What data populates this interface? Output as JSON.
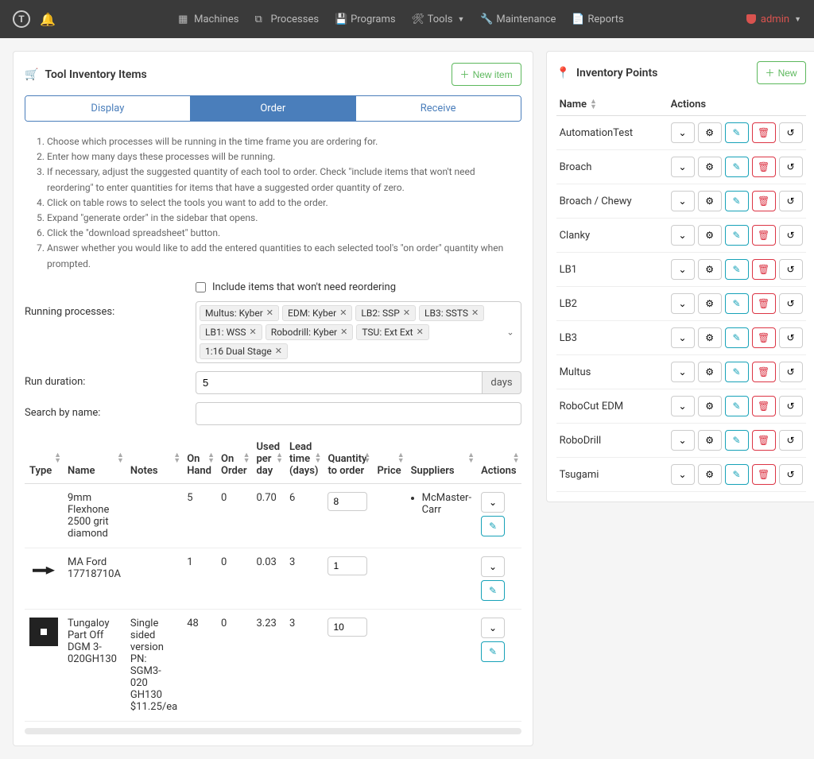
{
  "nav": {
    "items": [
      "Machines",
      "Processes",
      "Programs",
      "Tools",
      "Maintenance",
      "Reports"
    ],
    "user": "admin"
  },
  "left": {
    "title": "Tool Inventory Items",
    "new_btn": "New item",
    "tabs": {
      "display": "Display",
      "order": "Order",
      "receive": "Receive"
    },
    "instructions": [
      "Choose which processes will be running in the time frame you are ordering for.",
      "Enter how many days these processes will be running.",
      "If necessary, adjust the suggested quantity of each tool to order. Check \"include items that won't need reordering\" to enter quantities for items that have a suggested order quantity of zero.",
      "Click on table rows to select the tools you want to add to the order.",
      "Expand \"generate order\" in the sidebar that opens.",
      "Click the \"download spreadsheet\" button.",
      "Answer whether you would like to add the entered quantities to each selected tool's \"on order\" quantity when prompted."
    ],
    "include_label": "Include items that won't need reordering",
    "include_checked": false,
    "running_label": "Running processes:",
    "tags": [
      {
        "label": "Multus: Kyber",
        "removable": true
      },
      {
        "label": "EDM: Kyber",
        "removable": true
      },
      {
        "label": "LB2: SSP",
        "removable": true
      },
      {
        "label": "LB3: SSTS",
        "removable": true
      },
      {
        "label": "LB1: WSS",
        "removable": true
      },
      {
        "label": "Robodrill: Kyber",
        "removable": true
      },
      {
        "label": "TSU: Ext Ext",
        "removable": true
      },
      {
        "label": "1:16 Dual Stage",
        "removable": true
      }
    ],
    "duration_label": "Run duration:",
    "duration_value": "5",
    "duration_unit": "days",
    "search_label": "Search by name:",
    "search_value": "",
    "columns": [
      "Type",
      "Name",
      "Notes",
      "On Hand",
      "On Order",
      "Used per day",
      "Lead time (days)",
      "Quantity to order",
      "Price",
      "Suppliers",
      "Actions"
    ],
    "rows": [
      {
        "thumb": "",
        "name": "9mm Flexhone 2500 grit diamond",
        "notes": "",
        "on_hand": "5",
        "on_order": "0",
        "used_per_day": "0.70",
        "lead_time": "6",
        "qty": "8",
        "price": "",
        "suppliers": [
          "McMaster-Carr"
        ]
      },
      {
        "thumb": "shaft",
        "name": "MA Ford 17718710A",
        "notes": "",
        "on_hand": "1",
        "on_order": "0",
        "used_per_day": "0.03",
        "lead_time": "3",
        "qty": "1",
        "price": "",
        "suppliers": []
      },
      {
        "thumb": "square",
        "name": "Tungaloy Part Off DGM 3-020GH130",
        "notes": "Single sided version PN: SGM3-020 GH130 $11.25/ea",
        "on_hand": "48",
        "on_order": "0",
        "used_per_day": "3.23",
        "lead_time": "3",
        "qty": "10",
        "price": "",
        "suppliers": []
      }
    ]
  },
  "right": {
    "title": "Inventory Points",
    "new_btn": "New",
    "col_name": "Name",
    "col_actions": "Actions",
    "rows": [
      "AutomationTest",
      "Broach",
      "Broach / Chewy",
      "Clanky",
      "LB1",
      "LB2",
      "LB3",
      "Multus",
      "RoboCut EDM",
      "RoboDrill",
      "Tsugami"
    ]
  }
}
